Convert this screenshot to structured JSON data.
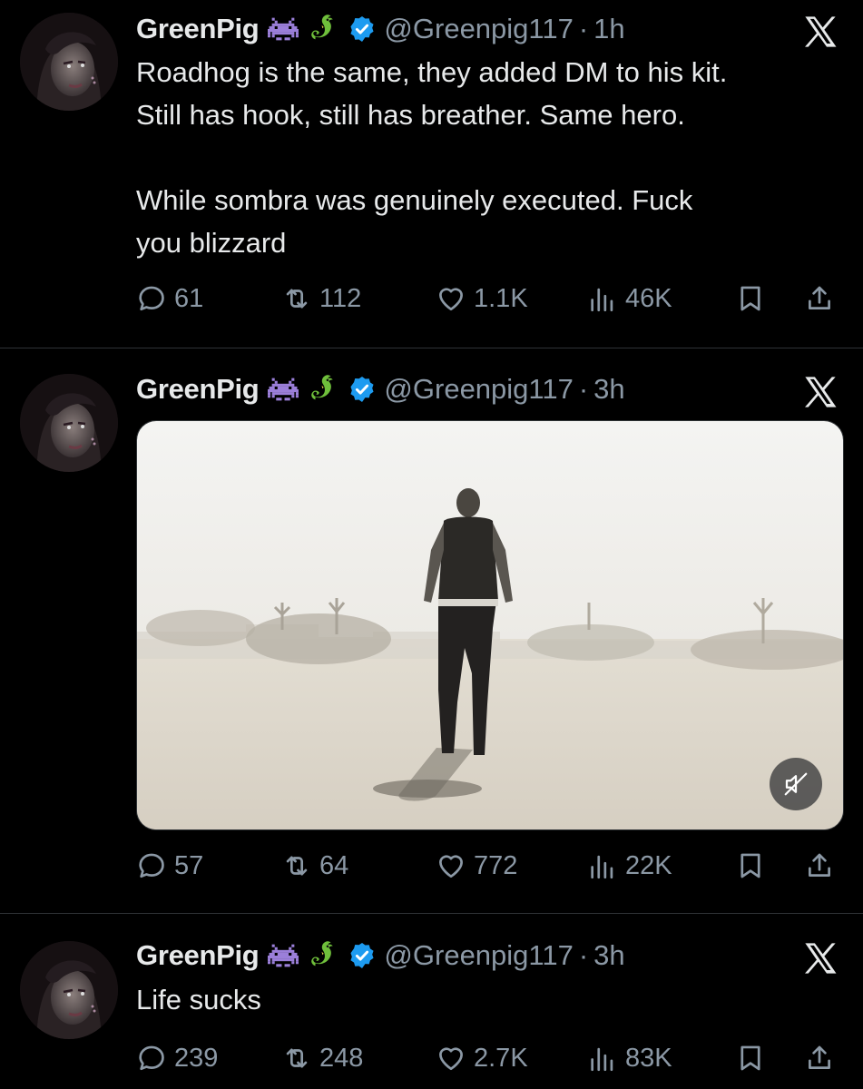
{
  "tweets": [
    {
      "name": "GreenPig",
      "handle": "@Greenpig117",
      "dot": "·",
      "time": "1h",
      "text": [
        "Roadhog is the same, they added DM to his kit.",
        "Still has hook, still has breather. Same hero.",
        "While sombra was genuinely executed. Fuck",
        "you blizzard"
      ],
      "replies": "61",
      "reposts": "112",
      "likes": "1.1K",
      "views": "46K"
    },
    {
      "name": "GreenPig",
      "handle": "@Greenpig117",
      "dot": "·",
      "time": "3h",
      "text": [],
      "media": {
        "type": "video",
        "muted": true,
        "icon": "muted-speaker-icon"
      },
      "replies": "57",
      "reposts": "64",
      "likes": "772",
      "views": "22K"
    },
    {
      "name": "GreenPig",
      "handle": "@Greenpig117",
      "dot": "·",
      "time": "3h",
      "text": [
        "Life sucks"
      ],
      "replies": "239",
      "reposts": "248",
      "likes": "2.7K",
      "views": "83K"
    }
  ],
  "icons": {
    "reply": "reply-icon",
    "repost": "repost-icon",
    "like": "heart-icon",
    "views": "views-icon",
    "bookmark": "bookmark-icon",
    "share": "share-icon",
    "verified": "verified-badge-icon",
    "platform": "x-logo-icon"
  },
  "colors": {
    "background": "#000000",
    "text": "#e7e9ea",
    "muted": "#8b98a5",
    "verified": "#1d9bf0",
    "divider": "#2f3336"
  }
}
